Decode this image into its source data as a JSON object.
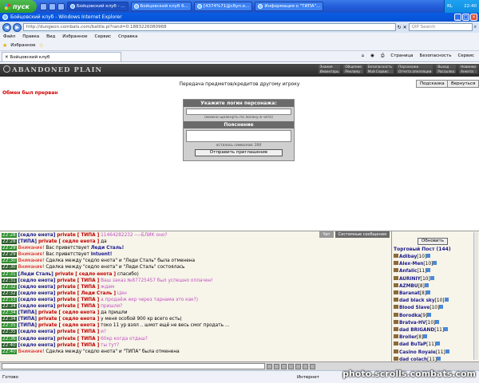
{
  "taskbar": {
    "start": "пуск",
    "tasks": [
      "Бойцовский клуб - ...",
      "Бойцовский клуб 6...",
      "[4374%71@сбуп.е...",
      "Информация о \"ТИПА\"..."
    ],
    "tray_lang": "RL",
    "tray_time": "22:40"
  },
  "window": {
    "title": "Бойцовский клуб - Windows Internet Explorer"
  },
  "address": {
    "url": "http://dungeon.combats.com/battle.pl?rand=0.1883226080968",
    "search_placeholder": "QIP Search"
  },
  "menu": [
    "Файл",
    "Правка",
    "Вид",
    "Избранное",
    "Сервис",
    "Справка"
  ],
  "favorites": {
    "label": "Избранное"
  },
  "tab": {
    "label": "Бойцовский клуб"
  },
  "tab_tools": [
    "Страница",
    "Безопасность",
    "Сервис"
  ],
  "game": {
    "logo": "ABANDONED PLAIN",
    "nav": [
      "Знания",
      "Общение",
      "Безопасность",
      "Персонажи",
      "Выход",
      "Новинки",
      "Инвентарь",
      "Рекламу",
      "Мой Сервис",
      "Отчета апелляции",
      "Рассылка",
      "Анкета"
    ],
    "subtitle": "Передача предметов/кредитов другому игроку",
    "btn_help": "Подсказка",
    "btn_back": "Вернуться",
    "error": "Обмен был прерван"
  },
  "form": {
    "login_header": "Укажите логин персонажа:",
    "login_hint": "(можно щелкнуть по логину в чате)",
    "comment_header": "Пояснение",
    "remaining": "осталось символов: 200",
    "send": "Отправить приглашение"
  },
  "chat": {
    "tab_chat": "Чат",
    "tab_system": "Системные сообщения",
    "messages": [
      {
        "time": "22:28",
        "parts": [
          [
            "nick",
            "[седло енота]"
          ],
          [
            "priv",
            " private [ ТИПА ]"
          ],
          [
            "pm",
            " 11464282232 ----БЛИК оно?"
          ]
        ]
      },
      {
        "time": "22:28",
        "parts": [
          [
            "nick",
            "[ТИПА]"
          ],
          [
            "priv",
            " private [ седло енота ]"
          ],
          [
            "plain",
            " да"
          ]
        ]
      },
      {
        "time": "22:29",
        "parts": [
          [
            "warn",
            "Внимание!"
          ],
          [
            "plain",
            " Вас приветствует "
          ],
          [
            "nick2",
            "Леди Сталь!"
          ]
        ]
      },
      {
        "time": "22:29",
        "parts": [
          [
            "warn",
            "Внимание!"
          ],
          [
            "plain",
            " Вас приветствует "
          ],
          [
            "nick2",
            "Intuent!"
          ]
        ]
      },
      {
        "time": "22:30",
        "parts": [
          [
            "warn",
            "Внимание!"
          ],
          [
            "plain",
            " Сделка между \"седло енота\" и \"Леди Сталь\" была отменена"
          ]
        ]
      },
      {
        "time": "22:30",
        "parts": [
          [
            "warn",
            "Внимание!"
          ],
          [
            "plain",
            " Сделка между \"седло енота\" и \"Леди Сталь\" состоялась"
          ]
        ]
      },
      {
        "time": "22:31",
        "parts": [
          [
            "nick",
            "[Леди Сталь]"
          ],
          [
            "priv",
            " private [ седло енота ]"
          ],
          [
            "plain",
            " спасибо)"
          ]
        ]
      },
      {
        "time": "22:31",
        "parts": [
          [
            "nick",
            "[седло енота]"
          ],
          [
            "priv",
            " private [ ТИПА ]"
          ],
          [
            "pm",
            " Ваш заказ №87725457 был успешно оплачен!"
          ]
        ]
      },
      {
        "time": "22:32",
        "parts": [
          [
            "nick",
            "[седло енота]"
          ],
          [
            "priv",
            " private [ ТИПА ]"
          ],
          [
            "pm",
            " ждем"
          ]
        ]
      },
      {
        "time": "22:32",
        "parts": [
          [
            "nick",
            "[седло енота]"
          ],
          [
            "priv",
            " private [ Леди Сталь ]"
          ],
          [
            "pm",
            " Цен"
          ]
        ]
      },
      {
        "time": "22:33",
        "parts": [
          [
            "nick",
            "[седло енота]"
          ],
          [
            "priv",
            " private [ ТИПА ]"
          ],
          [
            "pm",
            " а продаёж екр через тарнама это как?)"
          ]
        ]
      },
      {
        "time": "22:34",
        "parts": [
          [
            "nick",
            "[седло енота]"
          ],
          [
            "priv",
            " private [ ТИПА ]"
          ],
          [
            "pm",
            " пришли?"
          ]
        ]
      },
      {
        "time": "22:34",
        "parts": [
          [
            "nick",
            "[ТИПА]"
          ],
          [
            "priv",
            " private [ седло енота ]"
          ],
          [
            "plain",
            " да пришли"
          ]
        ]
      },
      {
        "time": "22:34",
        "parts": [
          [
            "nick",
            "[ТИПА]"
          ],
          [
            "priv",
            " private [ седло енота ]"
          ],
          [
            "plain",
            " у меня особой 900 кр всего есть("
          ]
        ]
      },
      {
        "time": "22:35",
        "parts": [
          [
            "nick",
            "[ТИПА]"
          ],
          [
            "priv",
            " private [ седло енота ]"
          ],
          [
            "plain",
            " токо 11 ур взял .. шмот ещё не весь смог продать ..."
          ]
        ]
      },
      {
        "time": "22:35",
        "parts": [
          [
            "nick",
            "[седло енота]"
          ],
          [
            "priv",
            " private [ ТИПА ]"
          ],
          [
            "pm",
            " и?"
          ]
        ]
      },
      {
        "time": "22:36",
        "parts": [
          [
            "nick",
            "[седло енота]"
          ],
          [
            "priv",
            " private [ ТИПА ]"
          ],
          [
            "pm",
            " 60кр когда отдаш?"
          ]
        ]
      },
      {
        "time": "22:40",
        "parts": [
          [
            "nick",
            "[седло енота]"
          ],
          [
            "priv",
            " private [ ТИПА ]"
          ],
          [
            "pm",
            " ты тут?"
          ]
        ]
      },
      {
        "time": "22:40",
        "parts": [
          [
            "warn",
            "Внимание!"
          ],
          [
            "plain",
            " Сделка между \"седло енота\" и \"ТИПА\" была отменена"
          ]
        ]
      }
    ]
  },
  "panel": {
    "refresh": "Обновить",
    "room": "Торговый Пост (144)",
    "users": [
      {
        "name": "Adibay",
        "lvl": "[10]"
      },
      {
        "name": "Alex-Men",
        "lvl": "[10]"
      },
      {
        "name": "Anfalic",
        "lvl": "[11]"
      },
      {
        "name": "AURINIY",
        "lvl": "[10]"
      },
      {
        "name": "AZMBU",
        "lvl": "[8]"
      },
      {
        "name": "Baranat",
        "lvl": "[8]"
      },
      {
        "name": "dad black sky",
        "lvl": "[10]"
      },
      {
        "name": "Blood Slave",
        "lvl": "[10]"
      },
      {
        "name": "Borodka",
        "lvl": "[9]"
      },
      {
        "name": "Bratva-HV",
        "lvl": "[10]"
      },
      {
        "name": "dad BRIGAND",
        "lvl": "[11]"
      },
      {
        "name": "Broller",
        "lvl": "[8]"
      },
      {
        "name": "dad BuTaP",
        "lvl": "[11]"
      },
      {
        "name": "Casino Royale",
        "lvl": "[11]"
      },
      {
        "name": "dad colach",
        "lvl": "[11]"
      }
    ]
  },
  "status": {
    "left": "Готово",
    "zone": "Интернет"
  },
  "watermark": "photo.scrolls.combats.com"
}
